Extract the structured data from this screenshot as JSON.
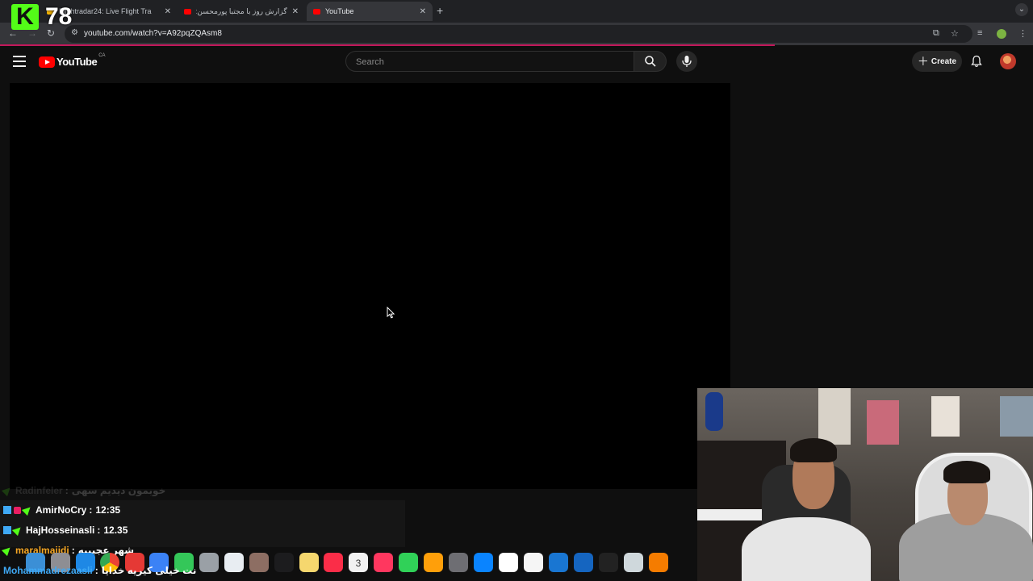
{
  "browser": {
    "tabs": [
      {
        "title": "Flightradar24: Live Flight Tra",
        "active": false
      },
      {
        "title": "گزارش روز با مجتبا پورمحسن: پشت",
        "active": false
      },
      {
        "title": "YouTube",
        "active": true
      }
    ],
    "new_tab": "+",
    "url": "youtube.com/watch?v=A92pqZQAsm8"
  },
  "overlay": {
    "kick_logo": "K",
    "viewer_count": "78"
  },
  "youtube": {
    "logo_text": "YouTube",
    "country_code": "CA",
    "search_placeholder": "Search",
    "create_label": "Create"
  },
  "chat": [
    {
      "user": "Radinfeler",
      "message": "خوبمون دیدیم سهی",
      "user_color": "#9e9e9e",
      "faded": true
    },
    {
      "user": "AmirNoCry",
      "message": "12:35",
      "user_color": "#ffffff",
      "faded": false
    },
    {
      "user": "HajHosseinasli",
      "message": "12.35",
      "user_color": "#ffffff",
      "faded": false
    },
    {
      "user": "maralmajidi",
      "message": "شهر عجیبیه",
      "user_color": "#f5a623",
      "faded": false
    },
    {
      "user": "Mohammadrezaasli",
      "message": "نت خیلی کیریه خدایا",
      "user_color": "#3fa9f5",
      "faded": false
    }
  ],
  "dock_icons": [
    "finder-icon",
    "launchpad-icon",
    "safari-icon",
    "chrome-icon",
    "mail-icon",
    "facetime-icon",
    "messages-icon",
    "maps-icon",
    "photos-icon",
    "appletv-icon",
    "notes-icon",
    "music-icon",
    "calendar-icon",
    "news-icon",
    "numbers-icon",
    "pages-icon",
    "settings-icon",
    "appstore-icon",
    "notion-icon",
    "notion-calendar-icon",
    "ableton-icon",
    "cubase-icon",
    "unity-icon",
    "utility-icon",
    "fl-studio-icon"
  ],
  "calendar_date": "3",
  "colors": {
    "youtube_red": "#ff0000",
    "kick_green": "#53fc18",
    "player_black": "#000000",
    "page_bg": "#0f0f0f"
  }
}
